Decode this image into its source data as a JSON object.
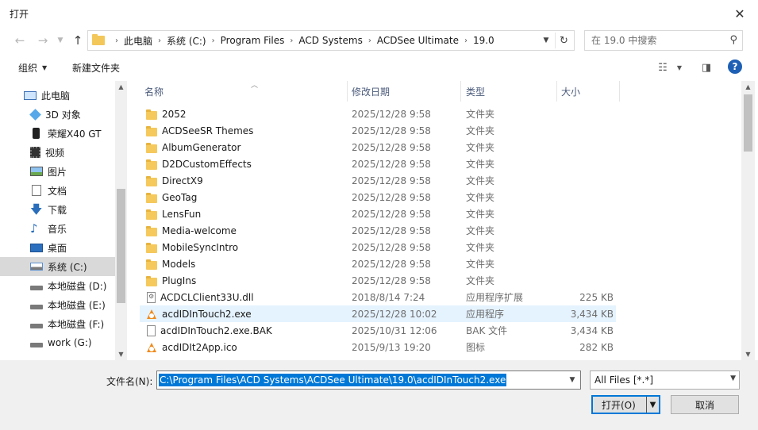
{
  "window": {
    "title": "打开",
    "close_symbol": "✕"
  },
  "navigation": {
    "breadcrumbs": [
      "此电脑",
      "系统 (C:)",
      "Program Files",
      "ACD Systems",
      "ACDSee Ultimate",
      "19.0"
    ],
    "search_placeholder": "在 19.0 中搜索"
  },
  "toolbar": {
    "organize_label": "组织",
    "new_folder_label": "新建文件夹",
    "help_symbol": "?"
  },
  "sidebar": {
    "items": [
      {
        "label": "此电脑",
        "icon": "computer-icon"
      },
      {
        "label": "3D 对象",
        "icon": "cube-icon"
      },
      {
        "label": "荣耀X40 GT",
        "icon": "phone-icon"
      },
      {
        "label": "视频",
        "icon": "video-icon"
      },
      {
        "label": "图片",
        "icon": "picture-icon"
      },
      {
        "label": "文档",
        "icon": "document-icon"
      },
      {
        "label": "下载",
        "icon": "download-icon"
      },
      {
        "label": "音乐",
        "icon": "music-icon"
      },
      {
        "label": "桌面",
        "icon": "desktop-icon"
      },
      {
        "label": "系统 (C:)",
        "icon": "system-drive-icon"
      },
      {
        "label": "本地磁盘 (D:)",
        "icon": "drive-icon"
      },
      {
        "label": "本地磁盘 (E:)",
        "icon": "drive-icon"
      },
      {
        "label": "本地磁盘 (F:)",
        "icon": "drive-icon"
      },
      {
        "label": "work (G:)",
        "icon": "network-drive-icon"
      }
    ],
    "selected_index": 9
  },
  "file_list": {
    "columns": {
      "name": "名称",
      "date": "修改日期",
      "type": "类型",
      "size": "大小"
    },
    "rows": [
      {
        "name": "2052",
        "date": "2025/12/28 9:58",
        "type": "文件夹",
        "size": "",
        "icon": "folder-icon"
      },
      {
        "name": "ACDSeeSR Themes",
        "date": "2025/12/28 9:58",
        "type": "文件夹",
        "size": "",
        "icon": "folder-icon"
      },
      {
        "name": "AlbumGenerator",
        "date": "2025/12/28 9:58",
        "type": "文件夹",
        "size": "",
        "icon": "folder-icon"
      },
      {
        "name": "D2DCustomEffects",
        "date": "2025/12/28 9:58",
        "type": "文件夹",
        "size": "",
        "icon": "folder-icon"
      },
      {
        "name": "DirectX9",
        "date": "2025/12/28 9:58",
        "type": "文件夹",
        "size": "",
        "icon": "folder-icon"
      },
      {
        "name": "GeoTag",
        "date": "2025/12/28 9:58",
        "type": "文件夹",
        "size": "",
        "icon": "folder-icon"
      },
      {
        "name": "LensFun",
        "date": "2025/12/28 9:58",
        "type": "文件夹",
        "size": "",
        "icon": "folder-icon"
      },
      {
        "name": "Media-welcome",
        "date": "2025/12/28 9:58",
        "type": "文件夹",
        "size": "",
        "icon": "folder-icon"
      },
      {
        "name": "MobileSyncIntro",
        "date": "2025/12/28 9:58",
        "type": "文件夹",
        "size": "",
        "icon": "folder-icon"
      },
      {
        "name": "Models",
        "date": "2025/12/28 9:58",
        "type": "文件夹",
        "size": "",
        "icon": "folder-icon"
      },
      {
        "name": "PlugIns",
        "date": "2025/12/28 9:58",
        "type": "文件夹",
        "size": "",
        "icon": "folder-icon"
      },
      {
        "name": "ACDCLClient33U.dll",
        "date": "2018/8/14 7:24",
        "type": "应用程序扩展",
        "size": "225 KB",
        "icon": "dll-icon"
      },
      {
        "name": "acdIDInTouch2.exe",
        "date": "2025/12/28 10:02",
        "type": "应用程序",
        "size": "3,434 KB",
        "icon": "acdsee-app-icon"
      },
      {
        "name": "acdIDInTouch2.exe.BAK",
        "date": "2025/10/31 12:06",
        "type": "BAK 文件",
        "size": "3,434 KB",
        "icon": "file-icon"
      },
      {
        "name": "acdIDIt2App.ico",
        "date": "2015/9/13 19:20",
        "type": "图标",
        "size": "282 KB",
        "icon": "acdsee-app-icon"
      }
    ],
    "hover_index": 12
  },
  "footer": {
    "filename_label": "文件名(N):",
    "filename_value": "C:\\Program Files\\ACD Systems\\ACDSee Ultimate\\19.0\\acdIDInTouch2.exe",
    "filetype_value": "All Files [*.*]",
    "open_label": "打开(O)",
    "cancel_label": "取消"
  }
}
